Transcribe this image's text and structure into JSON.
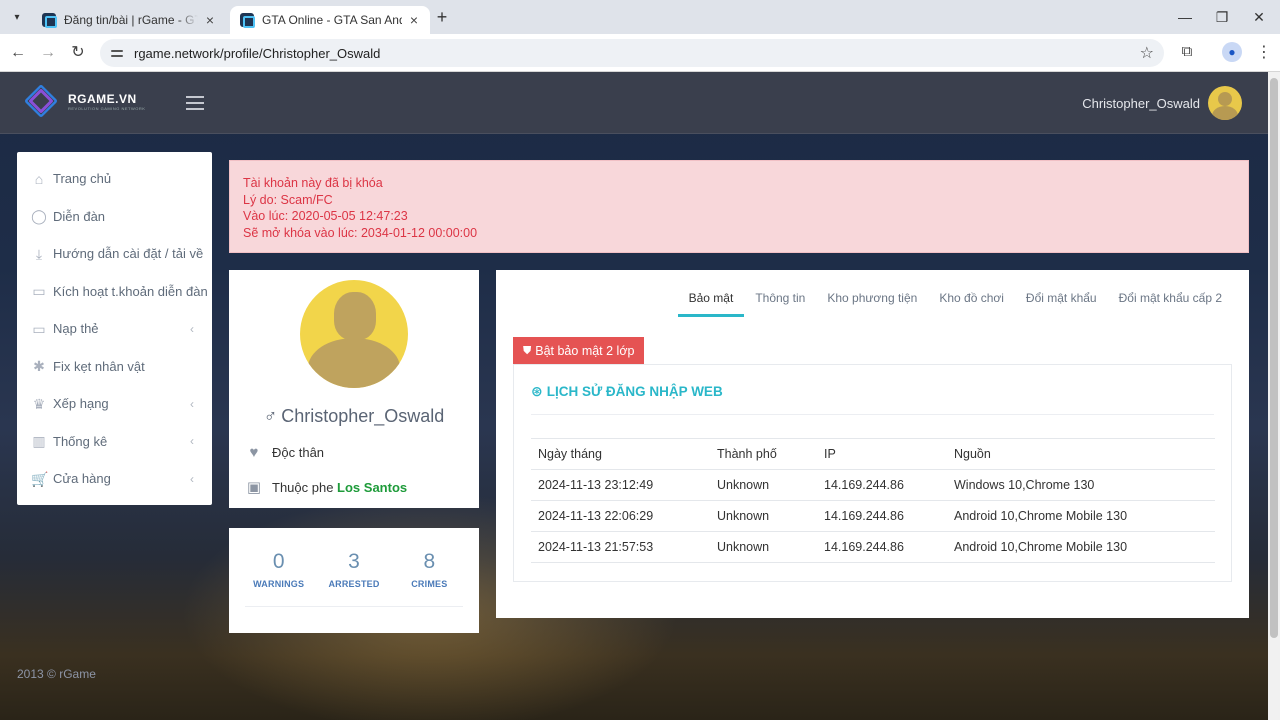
{
  "browser": {
    "tabs": [
      {
        "title": "Đăng tin/bài | rGame - GTA ONLINE",
        "active": false
      },
      {
        "title": "GTA Online - GTA San Andreas",
        "active": true
      }
    ],
    "url": "rgame.network/profile/Christopher_Oswald"
  },
  "header": {
    "logo_text": "RGAME.VN",
    "logo_sub": "REVOLUTION GAMING NETWORK",
    "username": "Christopher_Oswald"
  },
  "sidebar": {
    "items": [
      {
        "label": "Trang chủ",
        "icon": "home-icon",
        "has_chevron": false
      },
      {
        "label": "Diễn đàn",
        "icon": "chat-icon",
        "has_chevron": false
      },
      {
        "label": "Hướng dẫn cài đặt / tải về",
        "icon": "download-icon",
        "has_chevron": false
      },
      {
        "label": "Kích hoạt t.khoản diễn đàn",
        "icon": "card-icon",
        "has_chevron": false
      },
      {
        "label": "Nạp thẻ",
        "icon": "card-icon",
        "has_chevron": true
      },
      {
        "label": "Fix kẹt nhân vật",
        "icon": "asterisk-icon",
        "has_chevron": false
      },
      {
        "label": "Xếp hạng",
        "icon": "trophy-icon",
        "has_chevron": true
      },
      {
        "label": "Thống kê",
        "icon": "bar-chart-icon",
        "has_chevron": true
      },
      {
        "label": "Cửa hàng",
        "icon": "cart-icon",
        "has_chevron": true
      }
    ],
    "footer": "2013 © rGame"
  },
  "alert": {
    "line1": "Tài khoản này đã bị khóa",
    "line2": "Lý do: Scam/FC",
    "line3": "Vào lúc: 2020-05-05 12:47:23",
    "line4": "Sẽ mở khóa vào lúc: 2034-01-12 00:00:00"
  },
  "profile": {
    "name": "Christopher_Oswald",
    "gender_symbol": "♂",
    "status": "Độc thân",
    "gang_prefix": "Thuộc phe ",
    "gang": "Los Santos"
  },
  "stats": [
    {
      "value": "0",
      "label": "WARNINGS"
    },
    {
      "value": "3",
      "label": "ARRESTED"
    },
    {
      "value": "8",
      "label": "CRIMES"
    }
  ],
  "tabs": [
    "Bảo mật",
    "Thông tin",
    "Kho phương tiện",
    "Kho đồ chơi",
    "Đổi mật khẩu",
    "Đổi mật khẩu cấp 2"
  ],
  "security": {
    "button_2fa": "Bật bảo mật 2 lớp",
    "history_title": "LỊCH SỬ ĐĂNG NHẬP WEB",
    "columns": [
      "Ngày tháng",
      "Thành phố",
      "IP",
      "Nguồn"
    ],
    "rows": [
      [
        "2024-11-13 23:12:49",
        "Unknown",
        "14.169.244.86",
        "Windows 10,Chrome 130"
      ],
      [
        "2024-11-13 22:06:29",
        "Unknown",
        "14.169.244.86",
        "Android 10,Chrome Mobile 130"
      ],
      [
        "2024-11-13 21:57:53",
        "Unknown",
        "14.169.244.86",
        "Android 10,Chrome Mobile 130"
      ]
    ]
  },
  "colors": {
    "accent": "#2ab7c9",
    "danger": "#e55353",
    "gang": "#1e9b3a"
  }
}
